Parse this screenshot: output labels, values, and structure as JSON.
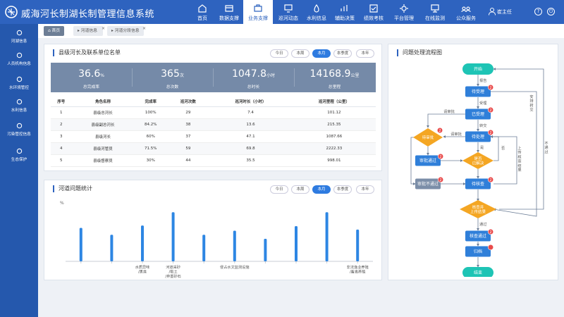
{
  "app": {
    "title": "威海河长制湖长制管理信息系统"
  },
  "nav": [
    {
      "label": "首页",
      "icon": "home-icon"
    },
    {
      "label": "数据支撑",
      "icon": "database-icon"
    },
    {
      "label": "业务支撑",
      "icon": "briefcase-icon",
      "active": true
    },
    {
      "label": "巡河动态",
      "icon": "monitor-icon"
    },
    {
      "label": "水利信息",
      "icon": "water-icon"
    },
    {
      "label": "辅助决策",
      "icon": "decision-icon"
    },
    {
      "label": "绩效考核",
      "icon": "assessment-icon"
    },
    {
      "label": "平台管理",
      "icon": "gear-icon"
    },
    {
      "label": "在线监测",
      "icon": "screen-icon"
    },
    {
      "label": "公众服务",
      "icon": "people-icon"
    }
  ],
  "user": {
    "name": "崔主任"
  },
  "sidebar": [
    {
      "label": "河湖信息",
      "icon": "boat-icon"
    },
    {
      "label": "人员机构信息",
      "icon": "person-icon"
    },
    {
      "label": "水环境管控",
      "icon": "leaf-icon"
    },
    {
      "label": "水利信息",
      "icon": "wave-icon"
    },
    {
      "label": "污染管控信息",
      "icon": "pollution-icon"
    },
    {
      "label": "生态保护",
      "icon": "eco-icon"
    }
  ],
  "tabs": [
    {
      "label": "首页",
      "active": true
    },
    {
      "label": "河道信息"
    },
    {
      "label": "河道分段信息"
    }
  ],
  "roster": {
    "title": "县级河长及联系单位名单",
    "periods": [
      "今日",
      "本周",
      "本月",
      "本季度",
      "本年"
    ],
    "active_period": "本月",
    "stats": [
      {
        "value": "36.6",
        "unit": "%",
        "label": "总完成率"
      },
      {
        "value": "365",
        "unit": "次",
        "label": "总次数"
      },
      {
        "value": "1047.8",
        "unit": "小时",
        "label": "总时长"
      },
      {
        "value": "14168.9",
        "unit": "公里",
        "label": "总里程"
      }
    ],
    "columns": [
      "序号",
      "角色名称",
      "完成率",
      "巡河次数",
      "巡河时长（小时）",
      "巡河里程（公里）"
    ],
    "rows": [
      [
        "1",
        "县级总河长",
        "100%",
        "29",
        "7.4",
        "101.12"
      ],
      [
        "2",
        "县级副总河长",
        "84.2%",
        "38",
        "13.6",
        "215.35"
      ],
      [
        "3",
        "县级河长",
        "60%",
        "37",
        "47.1",
        "1087.66"
      ],
      [
        "4",
        "县级河管员",
        "71.5%",
        "59",
        "69.8",
        "2222.33"
      ],
      [
        "5",
        "县级督察员",
        "30%",
        "44",
        "35.5",
        "998.01"
      ]
    ]
  },
  "issues": {
    "title": "河道问题统计",
    "periods": [
      "今日",
      "本周",
      "本月",
      "本季度",
      "本年"
    ],
    "active_period": "本月"
  },
  "chart_data": {
    "type": "bar",
    "ylabel": "%",
    "categories": [
      "",
      "",
      "水质异味/黑臭",
      "河道采砂/取土/弃置砂石",
      "",
      "侵占水文监测设施",
      "",
      "",
      "",
      "非法渔业养殖/畜禽养殖"
    ],
    "values": [
      58,
      46,
      62,
      85,
      46,
      53,
      39,
      61,
      85,
      55
    ],
    "ylim": [
      0,
      100
    ],
    "bar_color": "#2d86e3"
  },
  "flow": {
    "title": "问题处理流程图",
    "nodes": {
      "start": "开始",
      "pending_accept": "待受理",
      "accepted": "已受理",
      "pending_handle": "待处理",
      "pending_approve": "待审批",
      "approved": "审批通过",
      "resolved": "是否已解决",
      "rejected": "审批不通过",
      "pending_verify": "待核查",
      "upload_check": "核查并上传结果",
      "verify_pass": "核查通过",
      "archive": "归档",
      "end": "结束"
    },
    "edges": {
      "report": "报告",
      "accept": "受理",
      "transfer": "转交",
      "request": "请审批",
      "yes": "是",
      "no": "否",
      "reassign": "安排转交",
      "upload_result": "上传核查结果",
      "pass": "通过",
      "fail": "不通过"
    },
    "badges": [
      "2",
      "2",
      "2",
      "2",
      "2",
      "2",
      "2",
      "2"
    ],
    "colors": {
      "terminal": "#1ec4b5",
      "process": "#2f7fd9",
      "decision": "#f4a623",
      "rejected": "#7b8ea8"
    }
  }
}
